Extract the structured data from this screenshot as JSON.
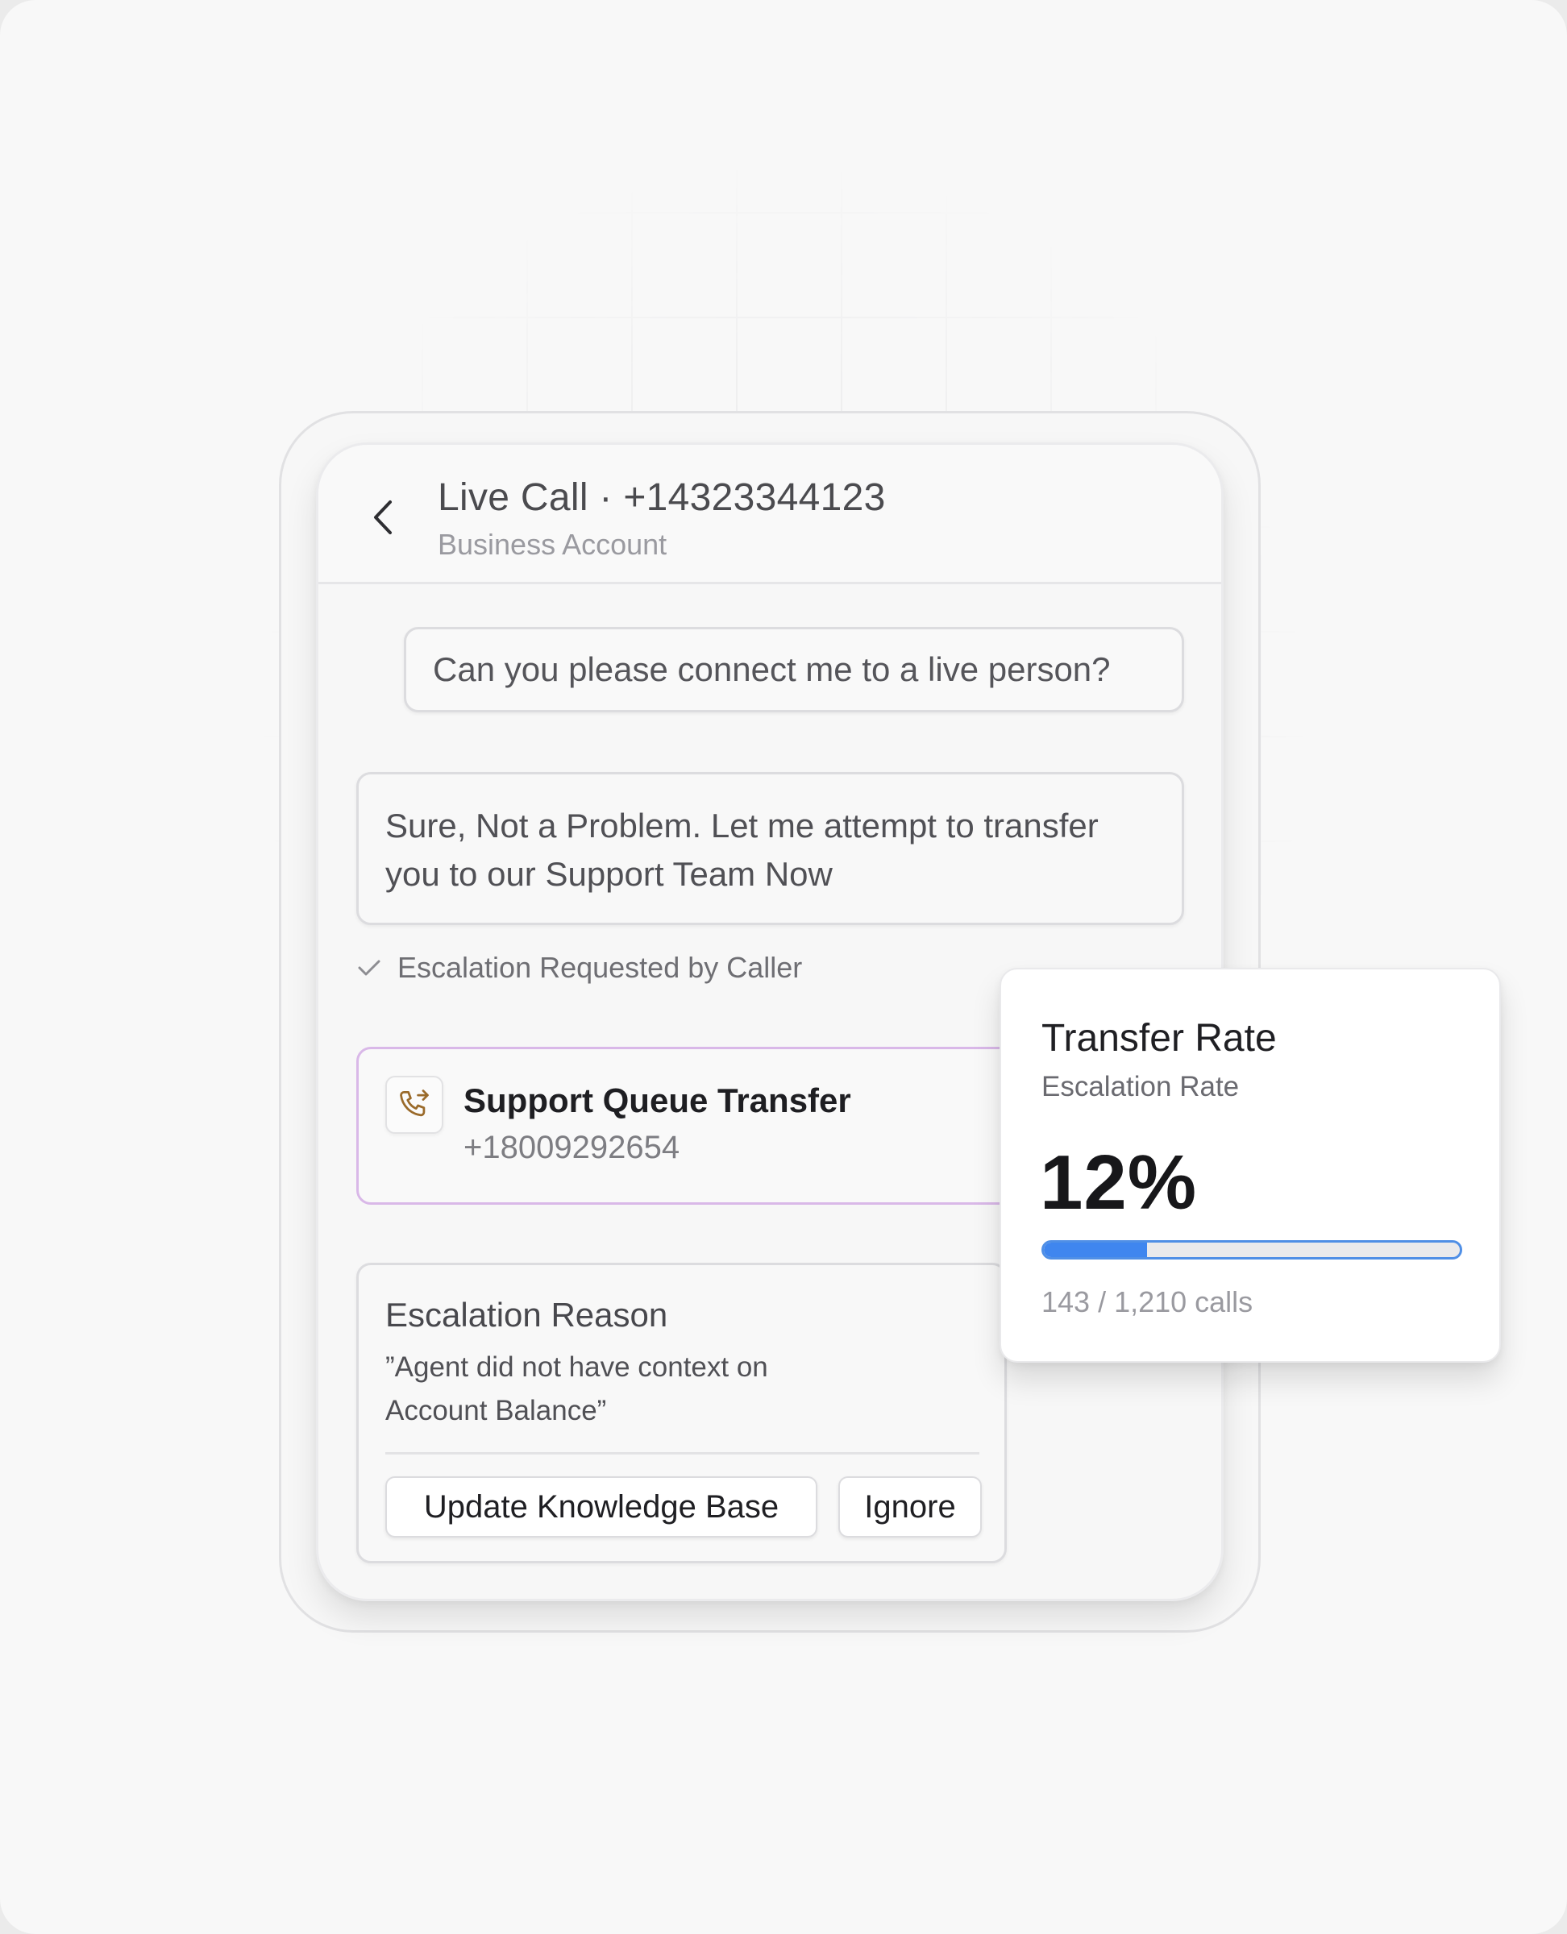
{
  "header": {
    "title": "Live Call · +14323344123",
    "subtitle": "Business Account",
    "back_icon": "chevron-left-icon"
  },
  "conversation": {
    "caller_message": "Can you please connect me to a live person?",
    "agent_message": "Sure, Not a Problem. Let me attempt to transfer you to our Support Team Now",
    "status_icon": "check-icon",
    "status_text": "Escalation Requested by Caller"
  },
  "transfer": {
    "icon": "phone-forward-icon",
    "title": "Support Queue Transfer",
    "number": "+18009292654",
    "accent_color": "#d9b8e8",
    "icon_color": "#9a6a2a"
  },
  "escalation": {
    "title": "Escalation Reason",
    "quote": "”Agent did not have context on Account Balance”",
    "buttons": {
      "update_label": "Update Knowledge Base",
      "ignore_label": "Ignore"
    }
  },
  "stats": {
    "title": "Transfer Rate",
    "subtitle": "Escalation Rate",
    "value": "12%",
    "progress_fraction": 0.1182,
    "caption": "143 / 1,210 calls",
    "accent_color": "#3f86ef"
  }
}
